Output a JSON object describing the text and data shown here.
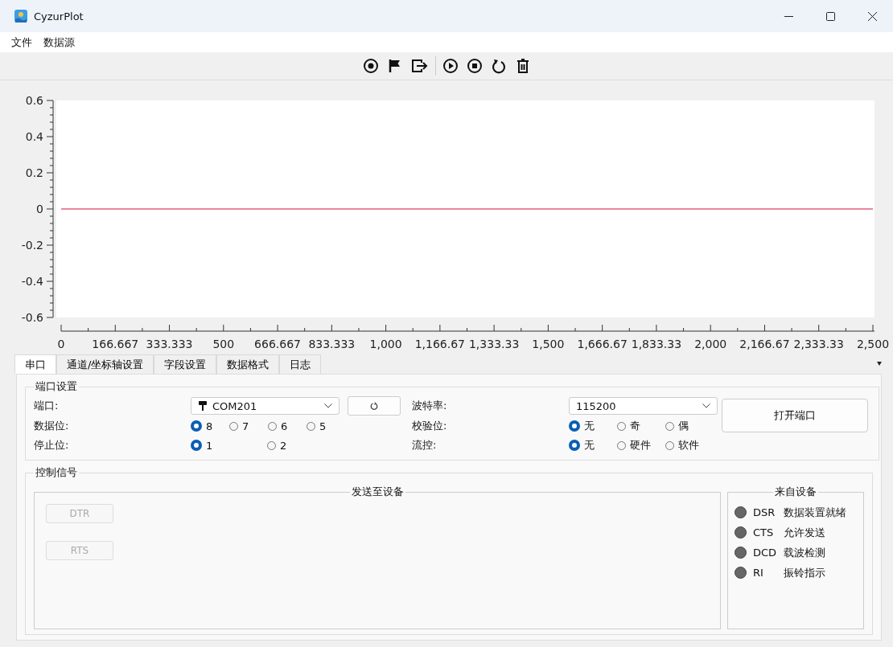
{
  "window": {
    "title": "CyzurPlot"
  },
  "menu": [
    {
      "label": "文件"
    },
    {
      "label": "数据源"
    }
  ],
  "plot": {
    "chart_data": {
      "type": "line",
      "x": [
        0,
        2500
      ],
      "series": [
        {
          "color": "#d0103a",
          "values": [
            0,
            0
          ]
        }
      ],
      "xlim": [
        0,
        2500
      ],
      "ylim": [
        -0.6,
        0.6
      ],
      "xticks": [
        {
          "value": 0,
          "label": "0"
        },
        {
          "value": 166.667,
          "label": "166.667"
        },
        {
          "value": 333.333,
          "label": "333.333"
        },
        {
          "value": 500,
          "label": "500"
        },
        {
          "value": 666.667,
          "label": "666.667"
        },
        {
          "value": 833.333,
          "label": "833.333"
        },
        {
          "value": 1000,
          "label": "1,000"
        },
        {
          "value": 1166.67,
          "label": "1,166.67"
        },
        {
          "value": 1333.33,
          "label": "1,333.33"
        },
        {
          "value": 1500,
          "label": "1,500"
        },
        {
          "value": 1666.67,
          "label": "1,666.67"
        },
        {
          "value": 1833.33,
          "label": "1,833.33"
        },
        {
          "value": 2000,
          "label": "2,000"
        },
        {
          "value": 2166.67,
          "label": "2,166.67"
        },
        {
          "value": 2333.33,
          "label": "2,333.33"
        },
        {
          "value": 2500,
          "label": "2,500"
        }
      ],
      "yticks": [
        {
          "value": 0.6,
          "label": "0.6"
        },
        {
          "value": 0.4,
          "label": "0.4"
        },
        {
          "value": 0.2,
          "label": "0.2"
        },
        {
          "value": 0,
          "label": "0"
        },
        {
          "value": -0.2,
          "label": "-0.2"
        },
        {
          "value": -0.4,
          "label": "-0.4"
        },
        {
          "value": -0.6,
          "label": "-0.6"
        }
      ]
    }
  },
  "tabs": [
    {
      "label": "串口",
      "selected": true
    },
    {
      "label": "通道/坐标轴设置",
      "selected": false
    },
    {
      "label": "字段设置",
      "selected": false
    },
    {
      "label": "数据格式",
      "selected": false
    },
    {
      "label": "日志",
      "selected": false
    }
  ],
  "port_settings": {
    "title": "端口设置",
    "port": {
      "label": "端口:",
      "value": "COM201"
    },
    "baud": {
      "label": "波特率:",
      "value": "115200"
    },
    "data_bits": {
      "label": "数据位:",
      "options": [
        {
          "label": "8",
          "selected": true
        },
        {
          "label": "7",
          "selected": false
        },
        {
          "label": "6",
          "selected": false
        },
        {
          "label": "5",
          "selected": false
        }
      ]
    },
    "parity": {
      "label": "校验位:",
      "options": [
        {
          "label": "无",
          "selected": true
        },
        {
          "label": "奇",
          "selected": false
        },
        {
          "label": "偶",
          "selected": false
        }
      ]
    },
    "stop_bits": {
      "label": "停止位:",
      "options": [
        {
          "label": "1",
          "selected": true
        },
        {
          "label": "2",
          "selected": false
        }
      ]
    },
    "flow": {
      "label": "流控:",
      "options": [
        {
          "label": "无",
          "selected": true
        },
        {
          "label": "硬件",
          "selected": false
        },
        {
          "label": "软件",
          "selected": false
        }
      ]
    },
    "open_button": "打开端口"
  },
  "control_signals": {
    "title": "控制信号",
    "send": {
      "title": "发送至设备",
      "buttons": [
        {
          "label": "DTR",
          "disabled": true
        },
        {
          "label": "RTS",
          "disabled": true
        }
      ]
    },
    "receive": {
      "title": "来自设备",
      "signals": [
        {
          "name": "DSR",
          "description": "数据装置就绪",
          "on": false
        },
        {
          "name": "CTS",
          "description": "允许发送",
          "on": false
        },
        {
          "name": "DCD",
          "description": "载波检测",
          "on": false
        },
        {
          "name": "RI",
          "description": "振铃指示",
          "on": false
        }
      ]
    }
  }
}
